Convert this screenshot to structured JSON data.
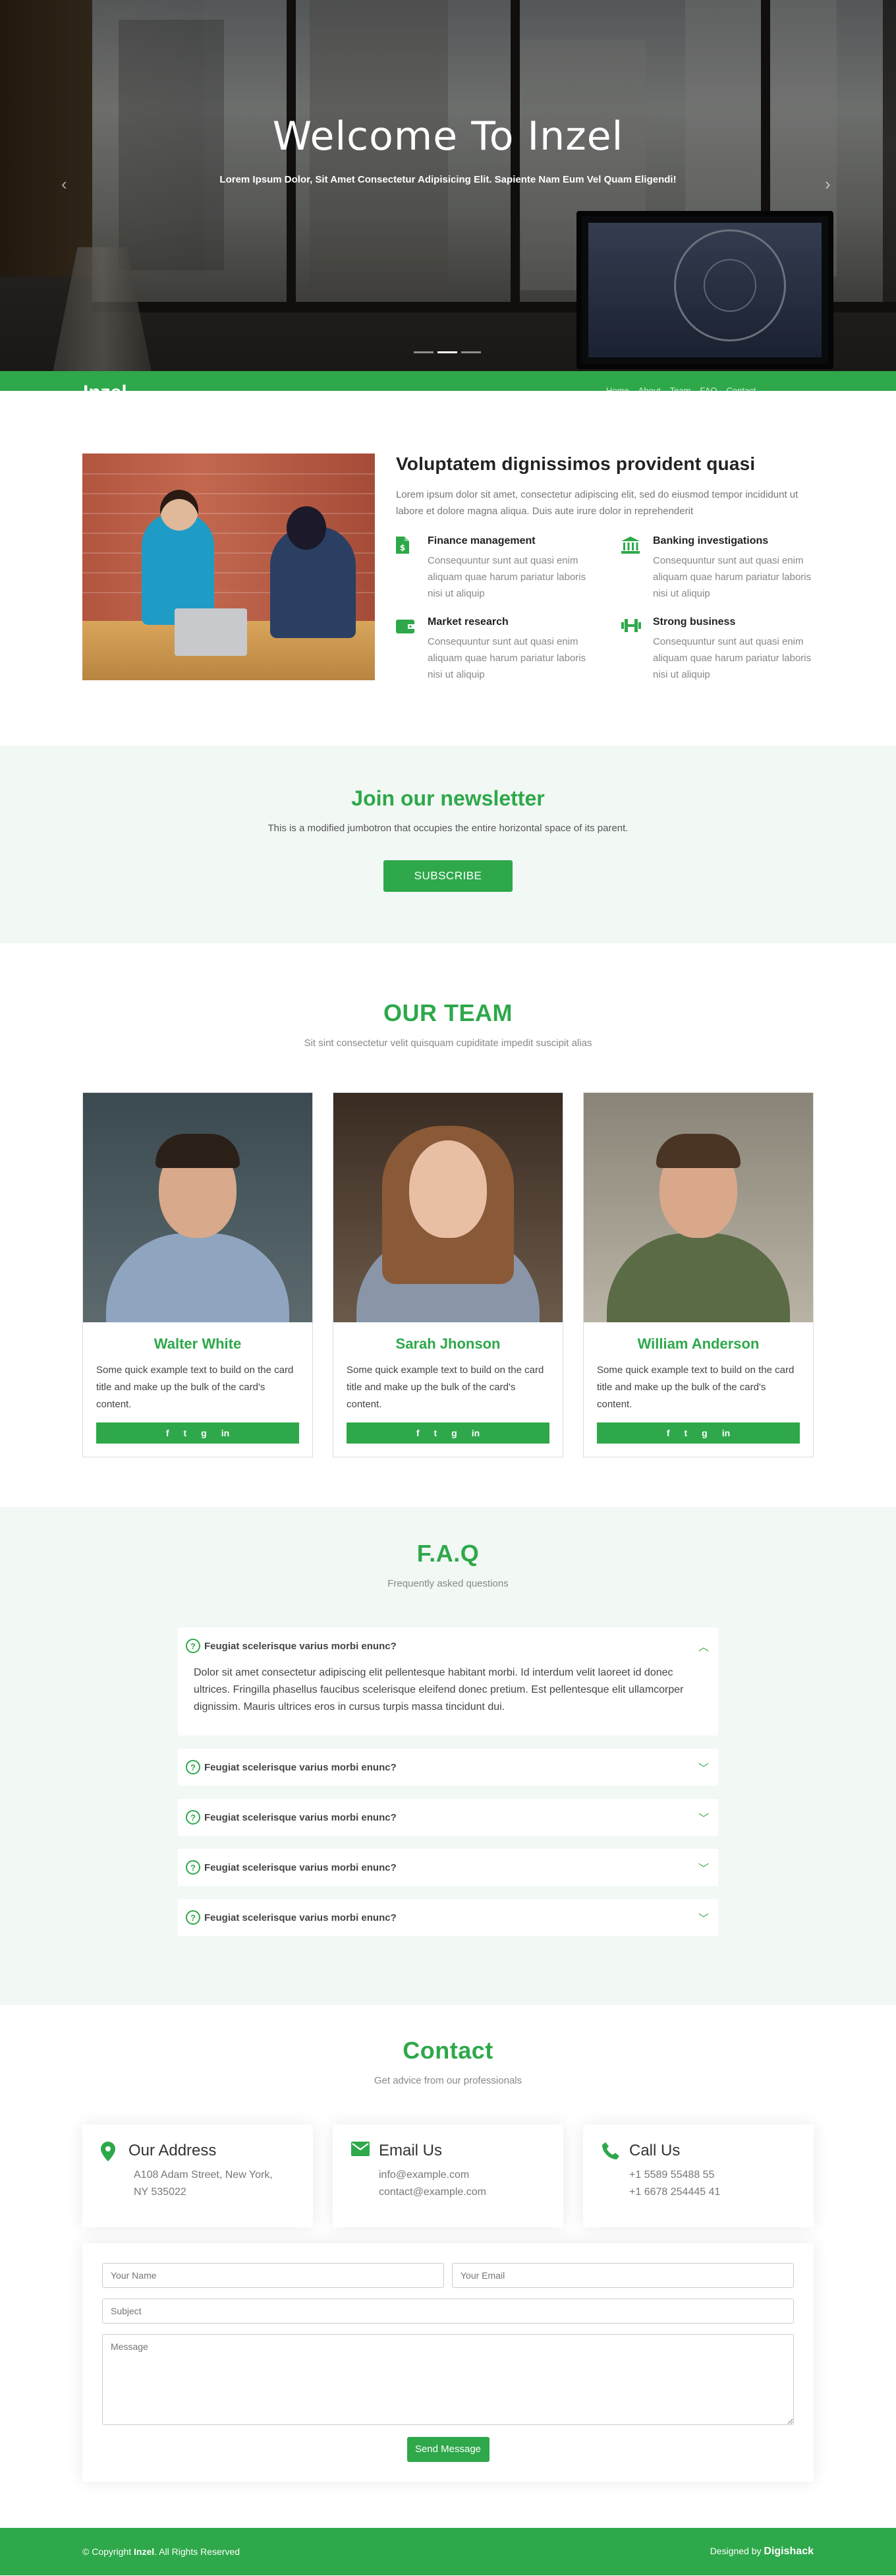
{
  "hero": {
    "title": "Welcome To Inzel",
    "subtitle": "Lorem Ipsum Dolor, Sit Amet Consectetur Adipisicing Elit. Sapiente Nam Eum Vel Quam Eligendi!",
    "prev_icon": "chevron-left-icon",
    "next_icon": "chevron-right-icon",
    "prev_glyph": "‹",
    "next_glyph": "›"
  },
  "navbar": {
    "logo": "Inzel",
    "links": [
      "Home",
      "About",
      "Team",
      "FAQ",
      "Contact"
    ]
  },
  "about": {
    "title": "Voluptatem dignissimos provident quasi",
    "lead": "Lorem ipsum dolor sit amet, consectetur adipiscing elit, sed do eiusmod tempor incididunt ut labore et dolore magna aliqua. Duis aute irure dolor in reprehenderit",
    "features": [
      {
        "icon": "document-dollar-icon",
        "title": "Finance management",
        "text": "Consequuntur sunt aut quasi enim aliquam quae harum pariatur laboris nisi ut aliquip"
      },
      {
        "icon": "bank-icon",
        "title": "Banking investigations",
        "text": "Consequuntur sunt aut quasi enim aliquam quae harum pariatur laboris nisi ut aliquip"
      },
      {
        "icon": "wallet-icon",
        "title": "Market research",
        "text": "Consequuntur sunt aut quasi enim aliquam quae harum pariatur laboris nisi ut aliquip"
      },
      {
        "icon": "dumbbell-icon",
        "title": "Strong business",
        "text": "Consequuntur sunt aut quasi enim aliquam quae harum pariatur laboris nisi ut aliquip"
      }
    ]
  },
  "newsletter": {
    "title": "Join our newsletter",
    "text": "This is a modified jumbotron that occupies the entire horizontal space of its parent.",
    "button": "SUBSCRIBE"
  },
  "team": {
    "title": "OUR TEAM",
    "subtitle": "Sit sint consectetur velit quisquam cupiditate impedit suscipit alias",
    "members": [
      {
        "name": "Walter White",
        "text": "Some quick example text to build on the card title and make up the bulk of the card's content."
      },
      {
        "name": "Sarah Jhonson",
        "text": "Some quick example text to build on the card title and make up the bulk of the card's content."
      },
      {
        "name": "William Anderson",
        "text": "Some quick example text to build on the card title and make up the bulk of the card's content."
      }
    ],
    "social": {
      "facebook": "f",
      "twitter": "t",
      "github": "g",
      "linkedin": "in"
    }
  },
  "faq": {
    "title": "F.A.Q",
    "subtitle": "Frequently asked questions",
    "items": [
      {
        "question": "Feugiat scelerisque varius morbi enunc?",
        "answer": "Dolor sit amet consectetur adipiscing elit pellentesque habitant morbi. Id interdum velit laoreet id donec ultrices. Fringilla phasellus faucibus scelerisque eleifend donec pretium. Est pellentesque elit ullamcorper dignissim. Mauris ultrices eros in cursus turpis massa tincidunt dui.",
        "open": true
      },
      {
        "question": "Feugiat scelerisque varius morbi enunc?",
        "open": false
      },
      {
        "question": "Feugiat scelerisque varius morbi enunc?",
        "open": false
      },
      {
        "question": "Feugiat scelerisque varius morbi enunc?",
        "open": false
      },
      {
        "question": "Feugiat scelerisque varius morbi enunc?",
        "open": false
      }
    ],
    "question_icon": "question-circle-icon",
    "question_glyph": "?",
    "chevron_up": "︿",
    "chevron_down": "﹀"
  },
  "contact": {
    "title": "Contact",
    "subtitle": "Get advice from our professionals",
    "address": {
      "title": "Our Address",
      "line1": "A108 Adam Street, New York,",
      "line2": "NY 535022"
    },
    "email": {
      "title": "Email Us",
      "line1": "info@example.com",
      "line2": "contact@example.com"
    },
    "phone": {
      "title": "Call Us",
      "line1": "+1 5589 55488 55",
      "line2": "+1 6678 254445 41"
    },
    "form": {
      "name_placeholder": "Your Name",
      "email_placeholder": "Your Email",
      "subject_placeholder": "Subject",
      "message_placeholder": "Message",
      "button": "Send Message"
    }
  },
  "footer": {
    "copyright_prefix": "© Copyright ",
    "copyright_brand": "Inzel",
    "copyright_suffix": ". All Rights Reserved",
    "designed_prefix": "Designed by ",
    "designed_brand": "Digishack"
  },
  "colors": {
    "accent": "#2ea84a",
    "section_bg": "#f2f8f4"
  }
}
